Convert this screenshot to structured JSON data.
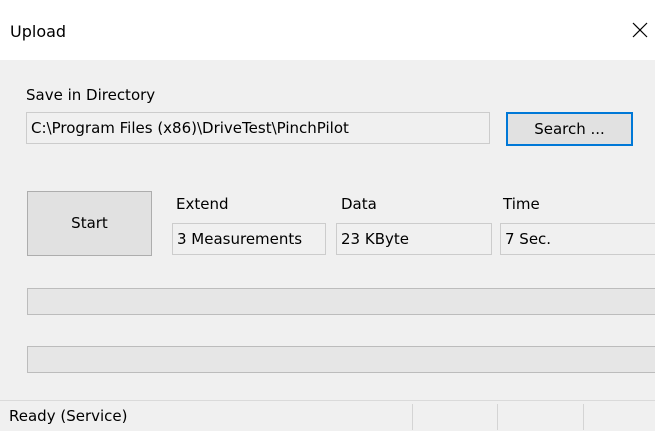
{
  "window": {
    "title": "Upload",
    "close_icon": "close-icon"
  },
  "directory": {
    "label": "Save in Directory",
    "path": "C:\\Program Files (x86)\\DriveTest\\PinchPilot",
    "search_label": "Search ..."
  },
  "start_label": "Start",
  "info": {
    "extend_label": "Extend",
    "extend_value": "3 Measurements",
    "data_label": "Data",
    "data_value": "23 KByte",
    "time_label": "Time",
    "time_value": "7 Sec."
  },
  "progress": {
    "bar1_value": 0,
    "bar2_value": 0
  },
  "status": {
    "text": "Ready (Service)"
  },
  "colors": {
    "accent": "#0078d7",
    "background": "#f0f0f0",
    "button_face": "#e1e1e1"
  }
}
